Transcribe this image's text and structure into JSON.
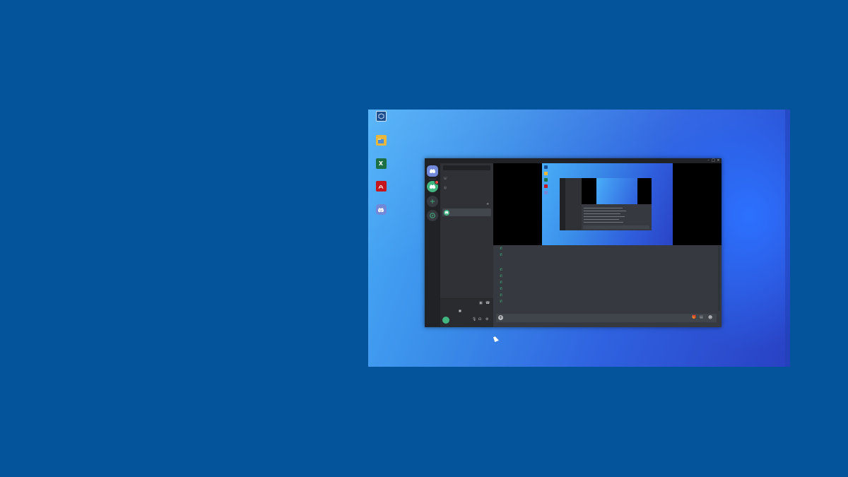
{
  "colors": {
    "outer_background": "#03549b",
    "discord_blurple": "#7289da",
    "online_green": "#43b581",
    "discord_dark": "#36393f"
  },
  "desktop": {
    "icons": [
      {
        "label": "",
        "icon": "app-cube-icon"
      },
      {
        "label": "",
        "icon": "folder-app-icon"
      },
      {
        "label": "",
        "icon": "excel-icon"
      },
      {
        "label": "",
        "icon": "acrobat-icon"
      },
      {
        "label": "",
        "icon": "discord-icon"
      }
    ]
  },
  "discord": {
    "title": "",
    "search_placeholder": "",
    "nav": [
      {
        "label": "",
        "icon": "friends-icon"
      },
      {
        "label": "",
        "icon": "nitro-icon"
      }
    ],
    "dm_header": "",
    "dm_add": "+",
    "dm_user": "",
    "voice": {
      "status": "",
      "sub": "",
      "video_label": ""
    },
    "user": {
      "name": "",
      "tag": ""
    },
    "messages": [
      {
        "author": "",
        "text": "",
        "time": ""
      },
      {
        "author": "",
        "text": "",
        "time": ""
      },
      {
        "date_divider": ""
      },
      {
        "author": "",
        "text": "",
        "time": ""
      },
      {
        "author": "",
        "text": "",
        "time": ""
      },
      {
        "author": "",
        "text": "",
        "time": ""
      },
      {
        "author": "",
        "text": "",
        "time": ""
      },
      {
        "author": "",
        "text": "",
        "time": ""
      },
      {
        "author": "",
        "text": "",
        "time": ""
      }
    ],
    "compose_placeholder": ""
  }
}
